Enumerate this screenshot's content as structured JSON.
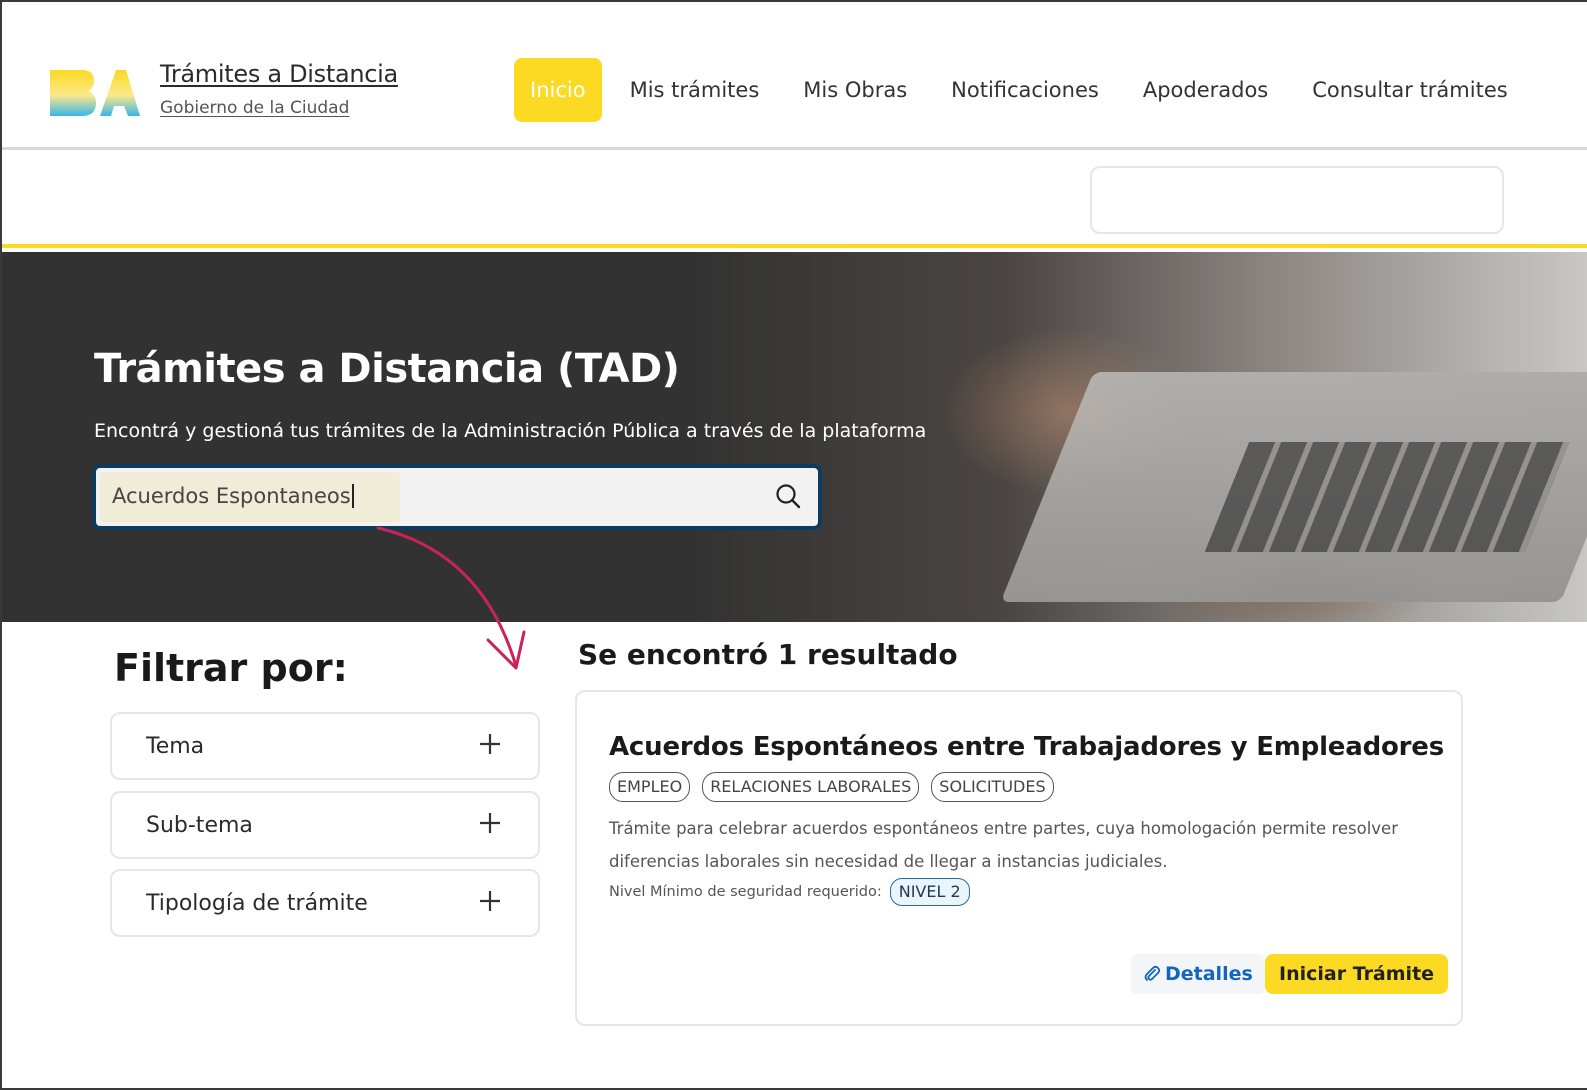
{
  "header": {
    "brand_title": "Trámites a Distancia",
    "brand_subtitle": "Gobierno de la Ciudad",
    "nav": [
      {
        "label": "Inicio",
        "active": true
      },
      {
        "label": "Mis trámites"
      },
      {
        "label": "Mis Obras"
      },
      {
        "label": "Notificaciones"
      },
      {
        "label": "Apoderados"
      },
      {
        "label": "Consultar trámites"
      }
    ]
  },
  "hero": {
    "title": "Trámites a Distancia (TAD)",
    "description": "Encontrá y gestioná tus trámites de la Administración Pública a través de la plataforma",
    "search_value": "Acuerdos Espontaneos"
  },
  "filters": {
    "title": "Filtrar por:",
    "items": [
      {
        "label": "Tema"
      },
      {
        "label": "Sub-tema"
      },
      {
        "label": "Tipología de trámite"
      }
    ]
  },
  "results": {
    "count_text": "Se encontró 1 resultado",
    "card": {
      "title": "Acuerdos Espontáneos entre Trabajadores y Empleadores",
      "tags": [
        "EMPLEO",
        "RELACIONES LABORALES",
        "SOLICITUDES"
      ],
      "description": "Trámite para celebrar acuerdos espontáneos entre partes, cuya homologación permite resolver diferencias laborales sin necesidad de llegar a instancias judiciales.",
      "level_label": "Nivel Mínimo de seguridad requerido:",
      "level_badge": "NIVEL 2",
      "details_label": "Detalles",
      "start_label": "Iniciar Trámite"
    }
  },
  "colors": {
    "accent_yellow": "#fcd923",
    "search_border": "#0e3a5c",
    "link_blue": "#1565c0",
    "annotation_arrow": "#c8235a"
  }
}
